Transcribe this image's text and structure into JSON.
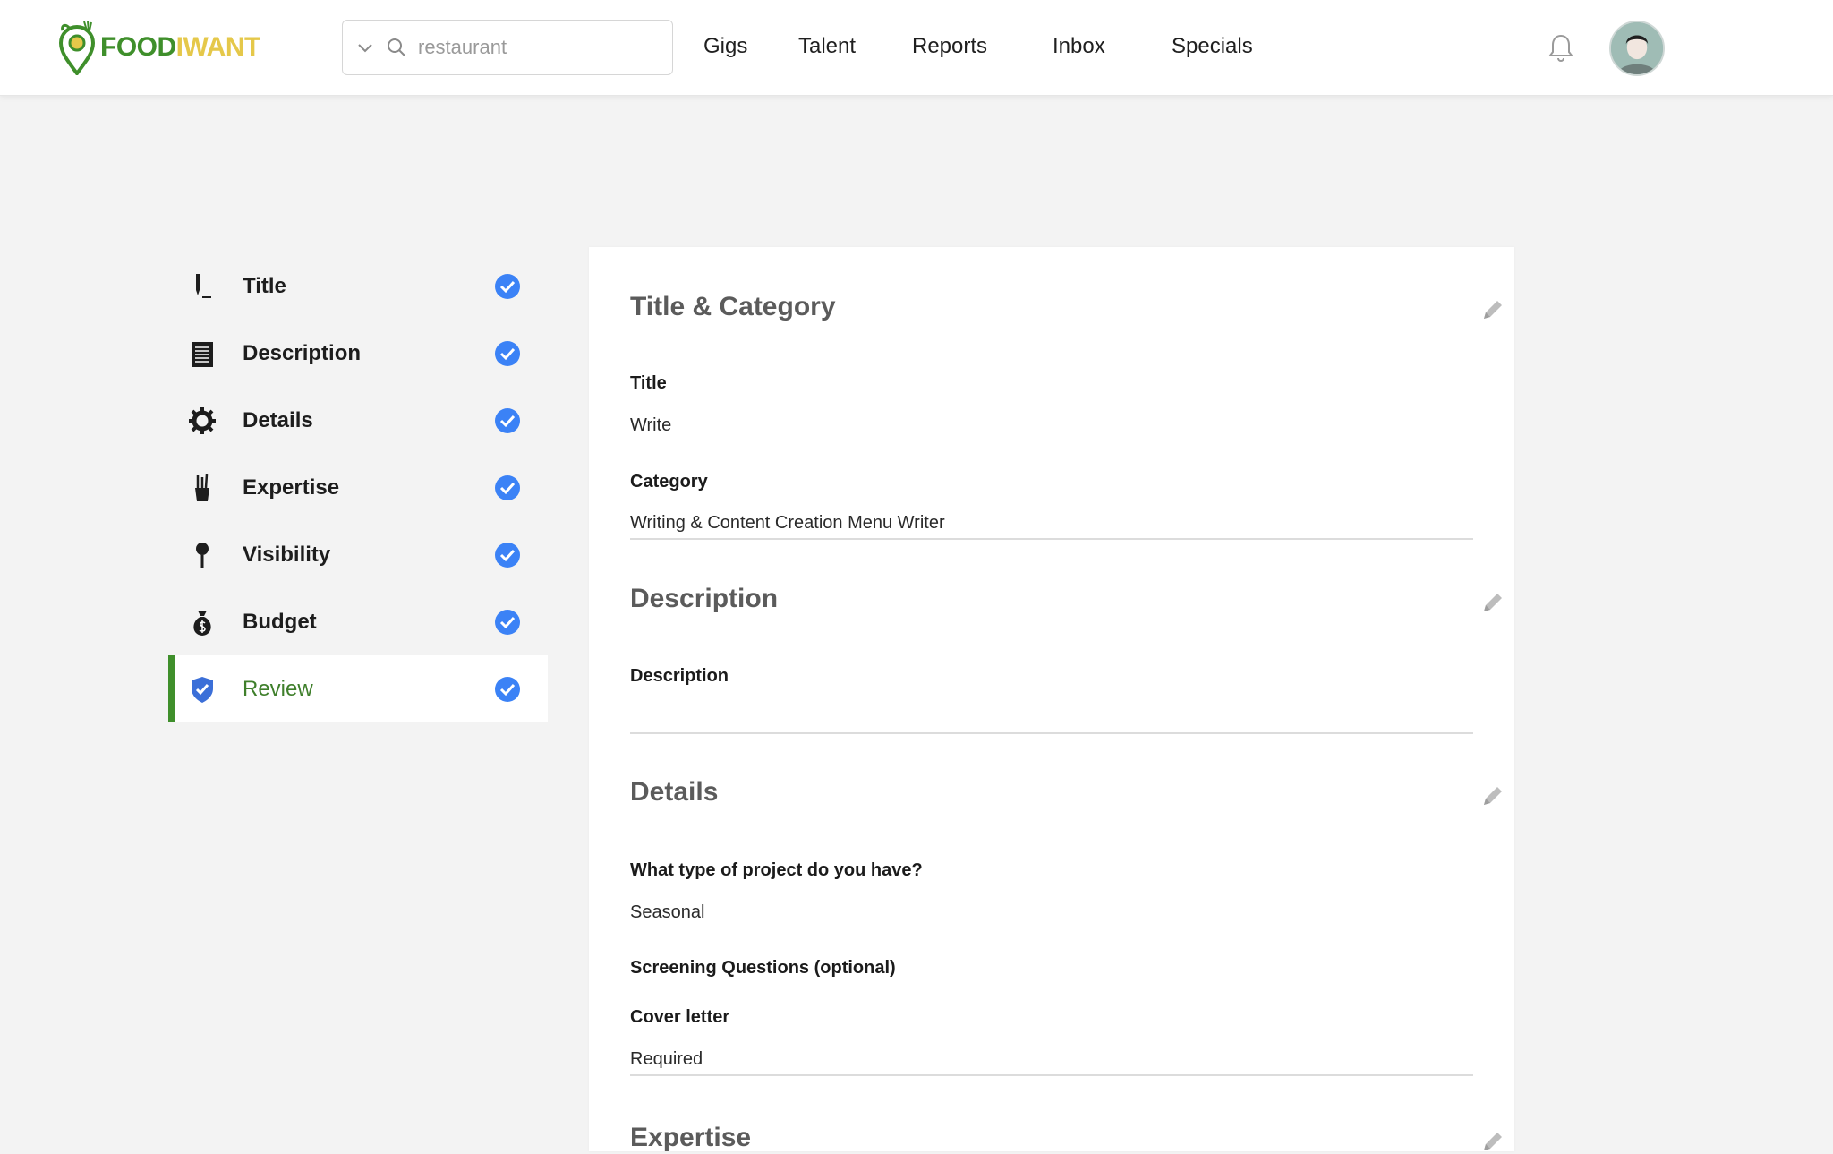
{
  "brand": {
    "part1": "FOOD",
    "part2": "IWANT",
    "color_primary": "#3f8f2b",
    "color_accent": "#e5c84a"
  },
  "search": {
    "placeholder": "restaurant",
    "value": ""
  },
  "nav": {
    "items": [
      "Gigs",
      "Talent",
      "Reports",
      "Inbox",
      "Specials"
    ]
  },
  "sidebar": {
    "items": [
      {
        "label": "Title",
        "icon": "pen-icon",
        "completed": true
      },
      {
        "label": "Description",
        "icon": "notepad-icon",
        "completed": true
      },
      {
        "label": "Details",
        "icon": "gear-icon",
        "completed": true
      },
      {
        "label": "Expertise",
        "icon": "pencil-cup-icon",
        "completed": true
      },
      {
        "label": "Visibility",
        "icon": "pin-icon",
        "completed": true
      },
      {
        "label": "Budget",
        "icon": "money-bag-icon",
        "completed": true
      },
      {
        "label": "Review",
        "icon": "shield-check-icon",
        "completed": true,
        "active": true
      }
    ]
  },
  "review": {
    "title_category": {
      "heading": "Title & Category",
      "title_label": "Title",
      "title_value": "Write",
      "category_label": "Category",
      "category_value": "Writing & Content Creation Menu Writer"
    },
    "description": {
      "heading": "Description",
      "description_label": "Description",
      "description_value": ""
    },
    "details": {
      "heading": "Details",
      "project_type_label": "What type of project do you have?",
      "project_type_value": "Seasonal",
      "screening_label": "Screening Questions (optional)",
      "cover_letter_label": "Cover letter",
      "cover_letter_value": "Required"
    },
    "expertise": {
      "heading": "Expertise"
    }
  }
}
